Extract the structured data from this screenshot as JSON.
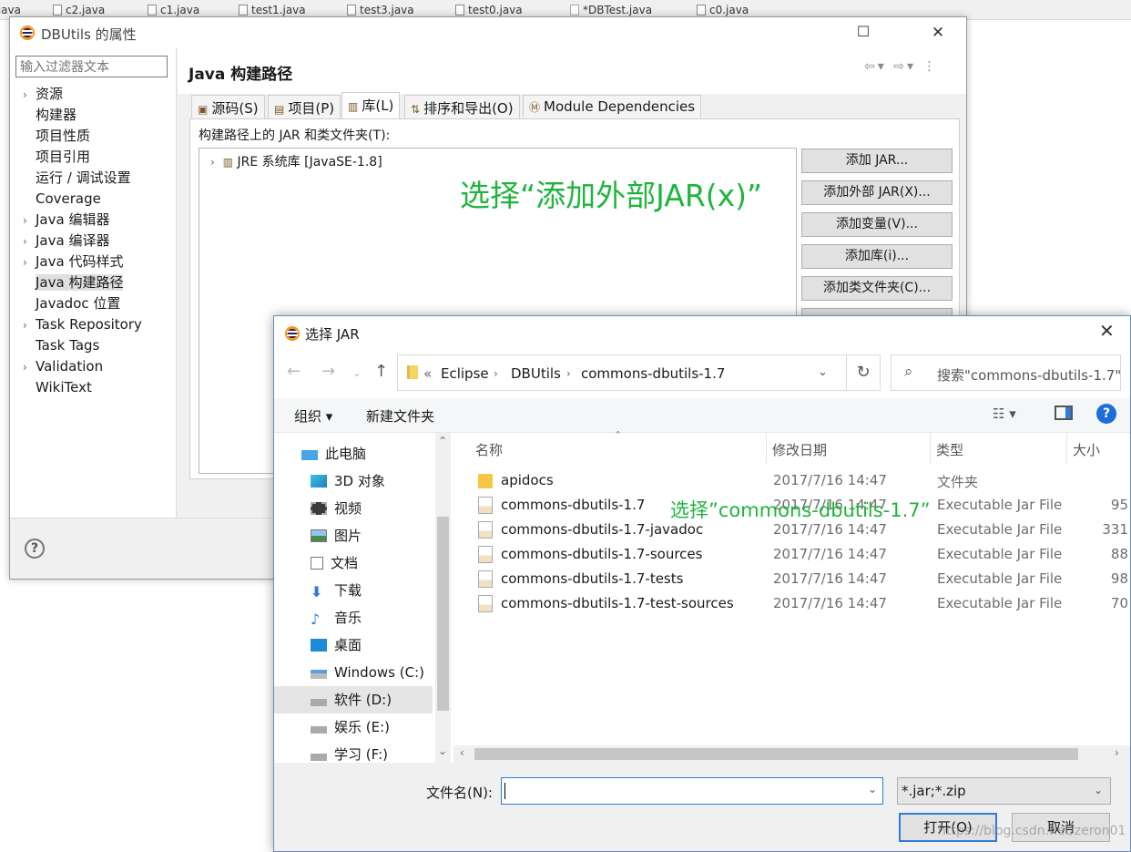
{
  "background_tabs": [
    ".java",
    "c2.java",
    "c1.java",
    "test1.java",
    "test3.java",
    "test0.java",
    "*DBTest.java",
    "c0.java"
  ],
  "properties_dialog": {
    "title": "DBUtils 的属性",
    "filter_placeholder": "输入过滤器文本",
    "nav_items": [
      {
        "label": "资源",
        "expandable": true
      },
      {
        "label": "构建器",
        "expandable": false
      },
      {
        "label": "项目性质",
        "expandable": false
      },
      {
        "label": "项目引用",
        "expandable": false
      },
      {
        "label": "运行 / 调试设置",
        "expandable": false
      },
      {
        "label": "Coverage",
        "expandable": false
      },
      {
        "label": "Java 编辑器",
        "expandable": true
      },
      {
        "label": "Java 编译器",
        "expandable": true
      },
      {
        "label": "Java 代码样式",
        "expandable": true
      },
      {
        "label": "Java 构建路径",
        "expandable": false,
        "selected": true
      },
      {
        "label": "Javadoc 位置",
        "expandable": false
      },
      {
        "label": "Task Repository",
        "expandable": true
      },
      {
        "label": "Task Tags",
        "expandable": false
      },
      {
        "label": "Validation",
        "expandable": true
      },
      {
        "label": "WikiText",
        "expandable": false
      }
    ],
    "page_title": "Java 构建路径",
    "tabs": [
      {
        "label": "源码(S)",
        "icon": "source-folder-icon"
      },
      {
        "label": "项目(P)",
        "icon": "project-icon"
      },
      {
        "label": "库(L)",
        "icon": "library-icon",
        "active": true
      },
      {
        "label": "排序和导出(O)",
        "icon": "order-icon"
      },
      {
        "label": "Module Dependencies",
        "icon": "module-icon"
      }
    ],
    "libraries_label": "构建路径上的 JAR 和类文件夹(T):",
    "jre_entry": "JRE 系统库 [JavaSE-1.8]",
    "buttons": [
      "添加 JAR...",
      "添加外部 JAR(X)...",
      "添加变量(V)...",
      "添加库(i)...",
      "添加类文件夹(C)..."
    ],
    "help_glyph": "?"
  },
  "annotations": {
    "step1": "选择“添加外部JAR(x)”",
    "step2": "选择”commons-dbutils-1.7”"
  },
  "jar_dialog": {
    "title": "选择 JAR",
    "breadcrumb": [
      "Eclipse",
      "DBUtils",
      "commons-dbutils-1.7"
    ],
    "breadcrumb_prefix": "«",
    "search_placeholder": "搜索\"commons-dbutils-1.7\"",
    "toolbar": {
      "organize": "组织 ▾",
      "new_folder": "新建文件夹"
    },
    "tree": [
      {
        "label": "此电脑",
        "icon": "computer-icon"
      },
      {
        "label": "3D 对象",
        "icon": "3d-objects-icon"
      },
      {
        "label": "视频",
        "icon": "video-icon"
      },
      {
        "label": "图片",
        "icon": "pictures-icon"
      },
      {
        "label": "文档",
        "icon": "documents-icon"
      },
      {
        "label": "下载",
        "icon": "download-icon"
      },
      {
        "label": "音乐",
        "icon": "music-icon"
      },
      {
        "label": "桌面",
        "icon": "desktop-icon"
      },
      {
        "label": "Windows (C:)",
        "icon": "drive-icon"
      },
      {
        "label": "软件 (D:)",
        "icon": "drive-icon",
        "selected": true
      },
      {
        "label": "娱乐 (E:)",
        "icon": "drive-icon"
      },
      {
        "label": "学习 (F:)",
        "icon": "drive-icon"
      }
    ],
    "columns": {
      "name": "名称",
      "date": "修改日期",
      "type": "类型",
      "size": "大小"
    },
    "files": [
      {
        "name": "apidocs",
        "date": "2017/7/16 14:47",
        "type": "文件夹",
        "size": "",
        "kind": "folder"
      },
      {
        "name": "commons-dbutils-1.7",
        "date": "2017/7/16 14:47",
        "type": "Executable Jar File",
        "size": "95",
        "kind": "jar"
      },
      {
        "name": "commons-dbutils-1.7-javadoc",
        "date": "2017/7/16 14:47",
        "type": "Executable Jar File",
        "size": "331",
        "kind": "jar"
      },
      {
        "name": "commons-dbutils-1.7-sources",
        "date": "2017/7/16 14:47",
        "type": "Executable Jar File",
        "size": "88",
        "kind": "jar"
      },
      {
        "name": "commons-dbutils-1.7-tests",
        "date": "2017/7/16 14:47",
        "type": "Executable Jar File",
        "size": "98",
        "kind": "jar"
      },
      {
        "name": "commons-dbutils-1.7-test-sources",
        "date": "2017/7/16 14:47",
        "type": "Executable Jar File",
        "size": "70",
        "kind": "jar"
      }
    ],
    "filename_label": "文件名(N):",
    "filename_value": "",
    "filter_value": "*.jar;*.zip",
    "open_button": "打开(O)",
    "cancel_button": "取消"
  },
  "watermark": "https://blog.csdn.net/zeron01"
}
